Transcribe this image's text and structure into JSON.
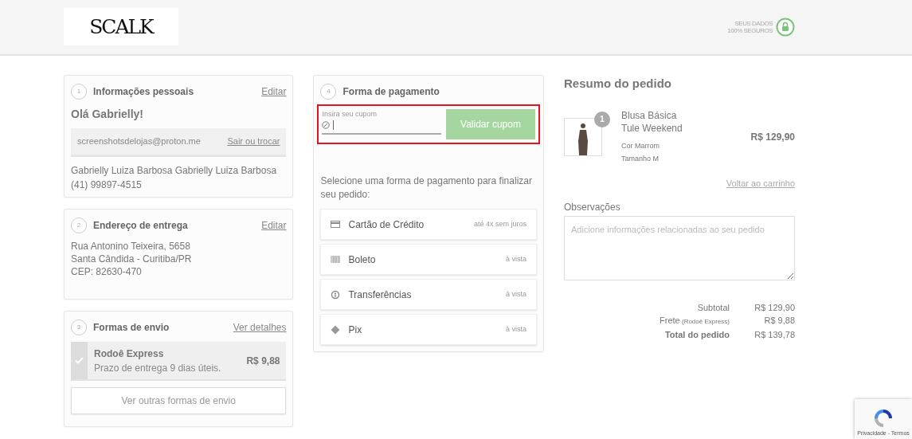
{
  "header": {
    "logo": "SCALK",
    "security": [
      "SEUS DADOS",
      "100% SEGUROS"
    ]
  },
  "personal": {
    "step": "1",
    "title": "Informações pessoais",
    "edit_link": "Editar",
    "greeting": "Olá Gabrielly!",
    "email": "screenshotsdelojas@proton.me",
    "switch_link": "Sair ou trocar",
    "lines": [
      "Gabrielly Luiza Barbosa Gabrielly Luiza Barbosa",
      "(41) 99897-4515"
    ]
  },
  "address": {
    "step": "2",
    "title": "Endereço de entrega",
    "edit_link": "Editar",
    "lines": [
      "Rua Antonino Teixeira, 5658",
      "Santa Cândida - Curitiba/PR",
      "CEP: 82630-470"
    ]
  },
  "shipping": {
    "step": "3",
    "title": "Formas de envio",
    "details_link": "Ver detalhes",
    "options": [
      {
        "name": "Rodoê Express",
        "eta": "Prazo de entrega 9 dias úteis.",
        "price": "R$ 9,88",
        "selected": true
      }
    ],
    "more_button": "Ver outras formas de envio"
  },
  "payment": {
    "step": "4",
    "title": "Forma de pagamento",
    "coupon": {
      "label": "Insira seu cupom",
      "button": "Validar cupom",
      "highlighted": true
    },
    "instruction": "Selecione uma forma de pagamento para finalizar seu pedido:",
    "methods": [
      {
        "kind": "card",
        "name": "Cartão de Crédito",
        "note": "até 4x sem juros"
      },
      {
        "kind": "boleto",
        "name": "Boleto",
        "note": "à vista"
      },
      {
        "kind": "transfer",
        "name": "Transferências",
        "note": "à vista"
      },
      {
        "kind": "pix",
        "name": "Pix",
        "note": "à vista"
      }
    ]
  },
  "summary": {
    "title": "Resumo do pedido",
    "items": [
      {
        "quantity": "1",
        "name": "Blusa Básica Tule Weekend",
        "color_text": "Cor Marrom",
        "size": "Tamanho M",
        "price": "R$ 129,90"
      }
    ],
    "back_link": "Voltar ao carrinho",
    "notes": {
      "label": "Observações",
      "placeholder": "Adicione informações relacionadas ao seu pedido"
    },
    "totals": [
      {
        "label": "Subtotal",
        "value": "R$ 129,90",
        "bold": false
      },
      {
        "label": "Frete",
        "detail": "(Rodoê Express)",
        "value": "R$ 9,88",
        "bold": false
      },
      {
        "label": "Total do pedido",
        "value": "R$ 139,78",
        "bold": true
      }
    ]
  },
  "recaptcha": {
    "text": "Privacidade - Termos"
  }
}
